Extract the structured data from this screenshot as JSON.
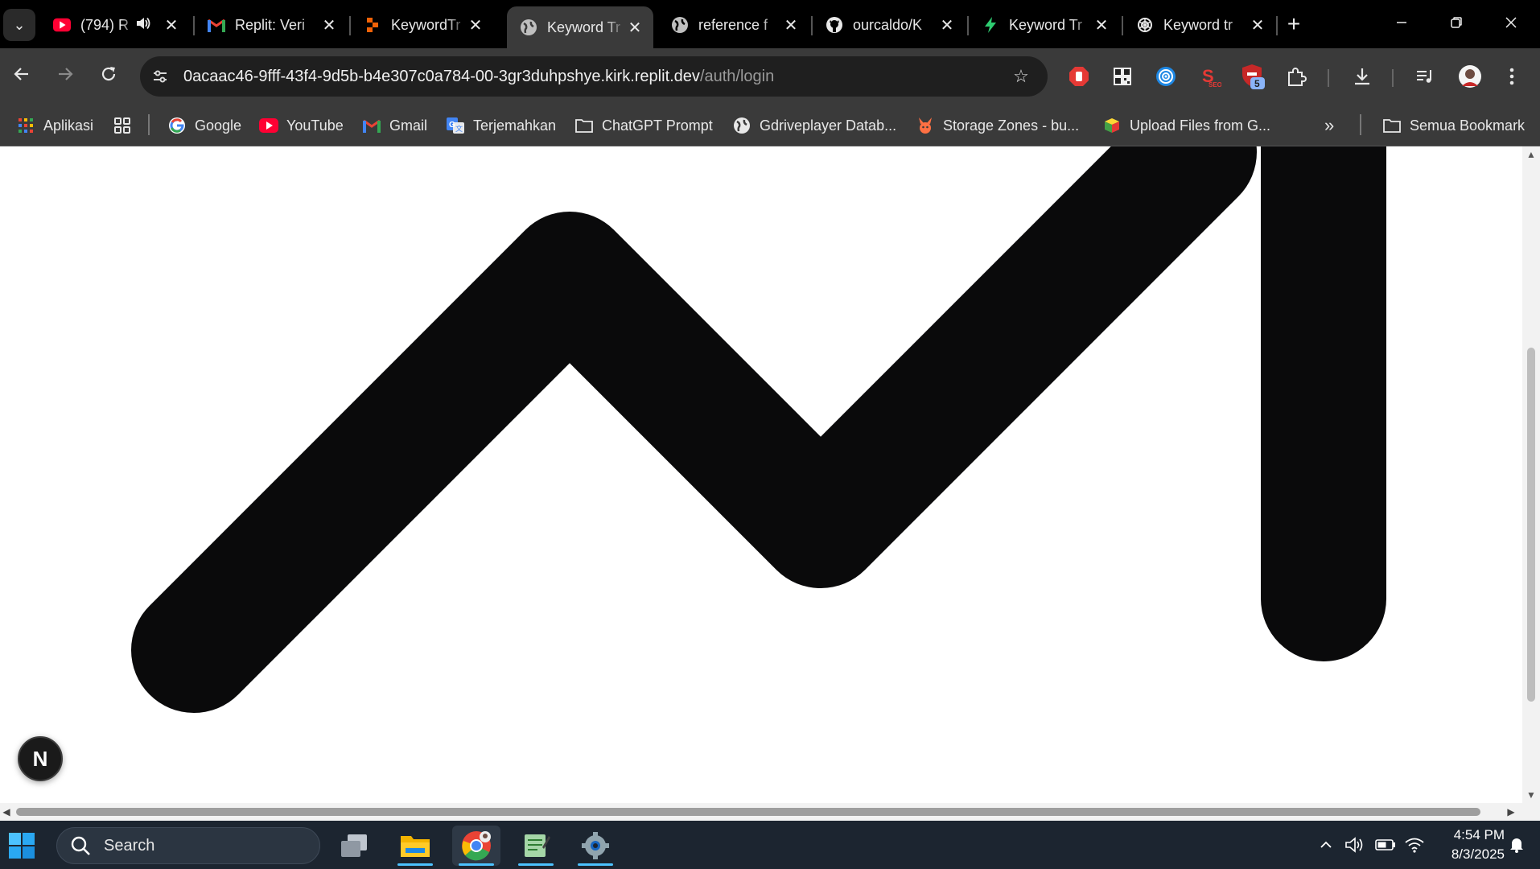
{
  "browser": {
    "tabs": [
      {
        "title": "(794) R",
        "favicon": "youtube-icon"
      },
      {
        "title": "Replit: Veri",
        "favicon": "gmail-icon"
      },
      {
        "title": "KeywordTr",
        "favicon": "replit-icon"
      },
      {
        "title": "Keyword Tr",
        "favicon": "globe-icon"
      },
      {
        "title": "reference f",
        "favicon": "globe-icon"
      },
      {
        "title": "ourcaldo/K",
        "favicon": "github-icon"
      },
      {
        "title": "Keyword Tr",
        "favicon": "bolt-icon"
      },
      {
        "title": "Keyword tr",
        "favicon": "openai-icon"
      }
    ],
    "active_tab": 3,
    "address_bar": {
      "host": "0acaac46-9fff-43f4-9d5b-b4e307c0a784-00-3gr3duhpshye.kirk.replit.dev",
      "path": "/auth/login"
    },
    "extension_badge": "5",
    "bookmarks": [
      {
        "label": "Aplikasi",
        "icon": "apps-grid-icon"
      },
      {
        "label": "Google",
        "icon": "google-icon"
      },
      {
        "label": "YouTube",
        "icon": "youtube-icon"
      },
      {
        "label": "Gmail",
        "icon": "gmail-icon"
      },
      {
        "label": "Terjemahkan",
        "icon": "translate-icon"
      },
      {
        "label": "ChatGPT Prompt",
        "icon": "folder-icon"
      },
      {
        "label": "Gdriveplayer Datab...",
        "icon": "globe-icon"
      },
      {
        "label": "Storage Zones - bu...",
        "icon": "bunny-icon"
      },
      {
        "label": "Upload Files from G...",
        "icon": "cube-icon"
      }
    ],
    "all_bookmarks_label": "Semua Bookmark"
  },
  "page": {
    "next_badge_letter": "N"
  },
  "taskbar": {
    "search_label": "Search",
    "time": "4:54 PM",
    "date": "8/3/2025"
  }
}
